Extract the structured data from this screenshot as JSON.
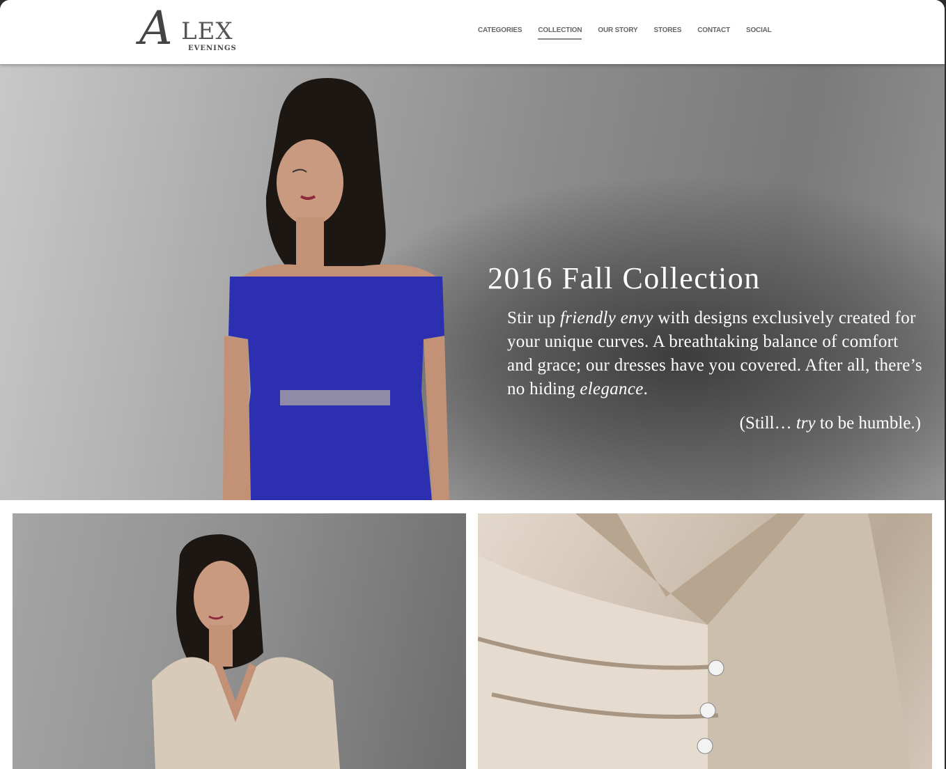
{
  "brand": {
    "logo_initial": "A",
    "logo_name": "LEX",
    "logo_tagline": "EVENINGS"
  },
  "nav": {
    "items": [
      {
        "label": "CATEGORIES"
      },
      {
        "label": "COLLECTION",
        "active": true
      },
      {
        "label": "OUR STORY"
      },
      {
        "label": "STORES"
      },
      {
        "label": "CONTACT"
      },
      {
        "label": "SOCIAL"
      }
    ]
  },
  "hero": {
    "title": "2016 Fall Collection",
    "body_part1": "Stir up ",
    "body_em1": "friendly envy",
    "body_part2": " with designs exclusively created for your unique curves.  A breathtaking balance of comfort and grace; our dresses have you covered.  After all, there’s no hiding ",
    "body_em2": "elegance",
    "body_part3": ".",
    "humble_part1": "(Still… ",
    "humble_em": "try",
    "humble_part2": " to be humble.)",
    "dress_color": "#2b2fb0"
  },
  "gallery": {
    "left_dress_color": "#d8cab9",
    "right_fabric_color": "#cbbcab"
  }
}
